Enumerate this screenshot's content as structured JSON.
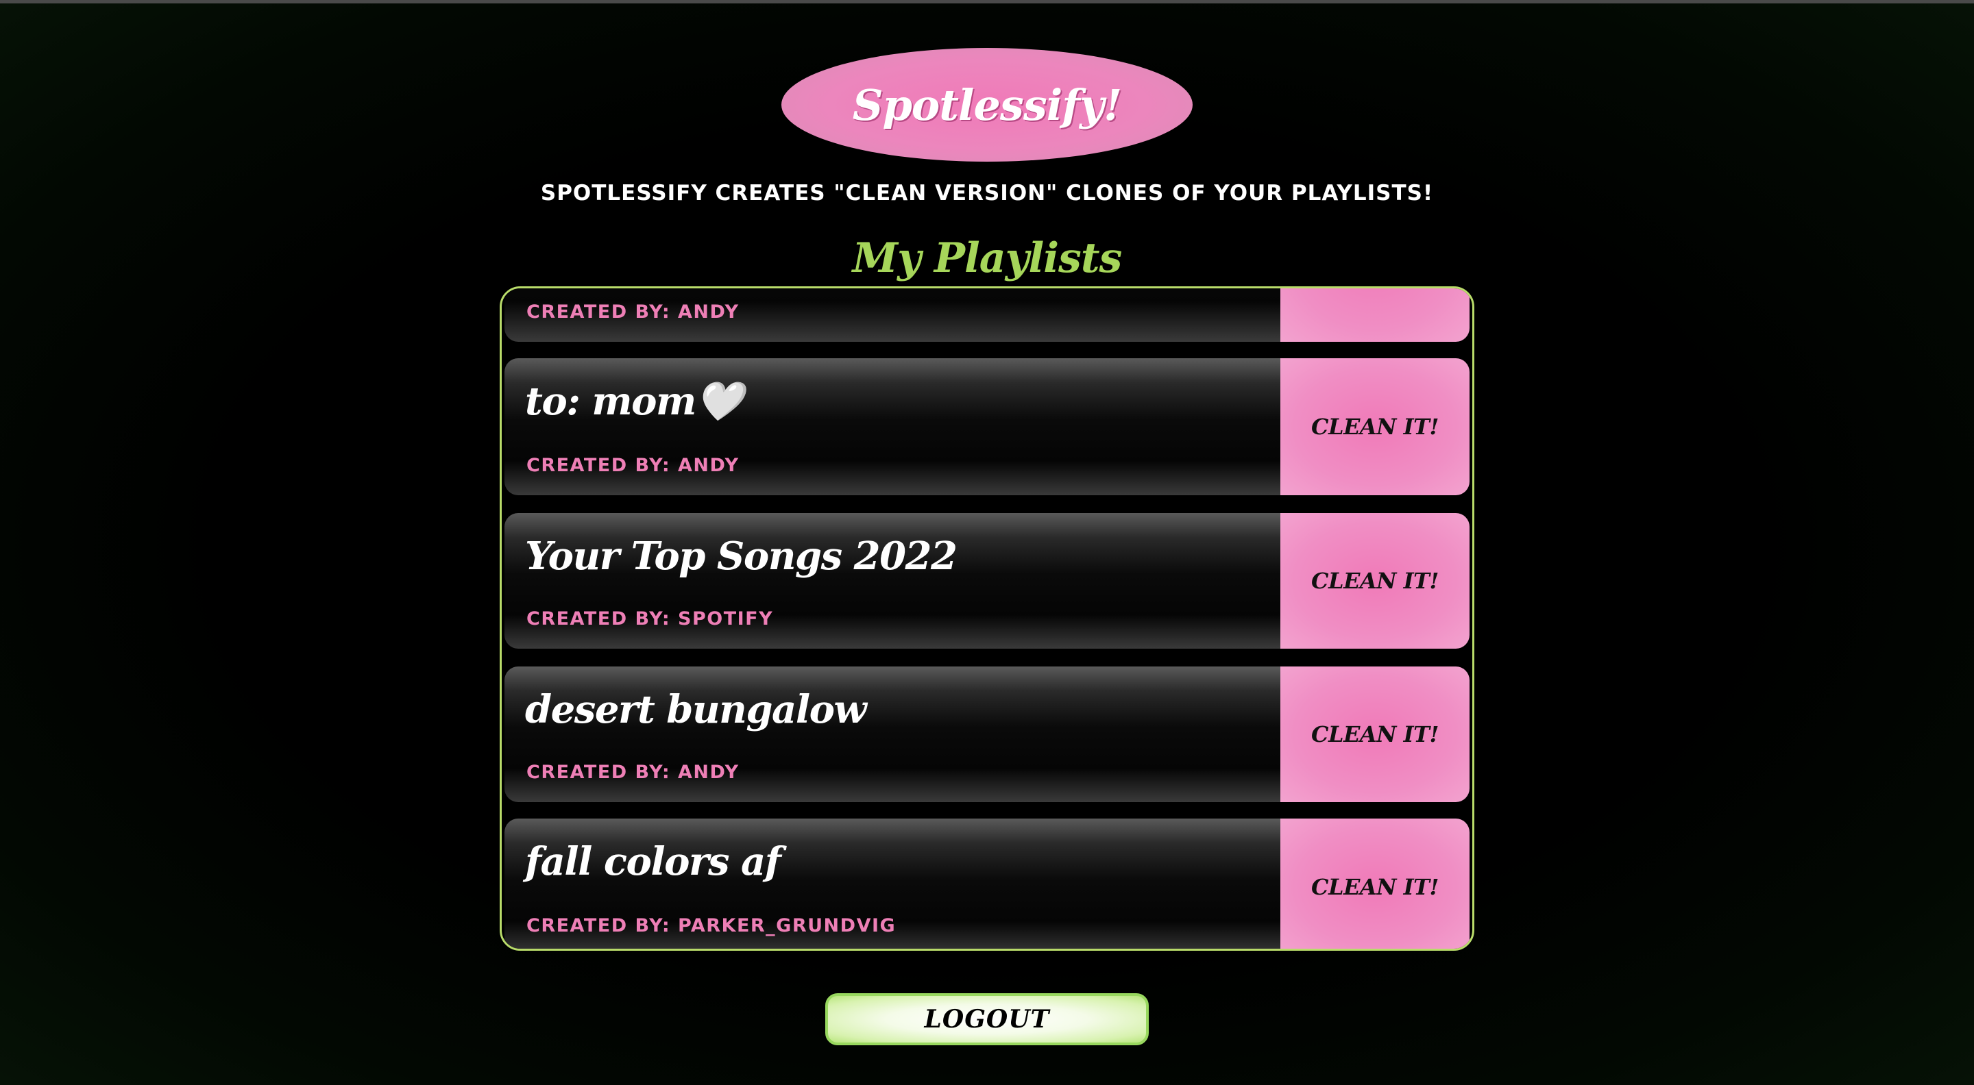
{
  "app": {
    "logo_text": "Spotlessify!",
    "tagline": "Spotlessify creates \"clean version\" clones of your playlists!",
    "section_title": "My Playlists"
  },
  "colors": {
    "pink": "#f07ab8",
    "green": "#a6d65a",
    "background": "#000000"
  },
  "playlists": [
    {
      "name": "",
      "created_by": "CREATED BY: ANDY",
      "button_label": ""
    },
    {
      "name": "to: mom🤍",
      "created_by": "CREATED BY: ANDY",
      "button_label": "CLEAN IT!"
    },
    {
      "name": "Your Top Songs 2022",
      "created_by": "CREATED BY: SPOTIFY",
      "button_label": "CLEAN IT!"
    },
    {
      "name": "desert bungalow",
      "created_by": "CREATED BY: ANDY",
      "button_label": "CLEAN IT!"
    },
    {
      "name": "fall colors af",
      "created_by": "CREATED BY: PARKER_GRUNDVIG",
      "button_label": "CLEAN IT!"
    }
  ],
  "logout_label": "LOGOUT"
}
